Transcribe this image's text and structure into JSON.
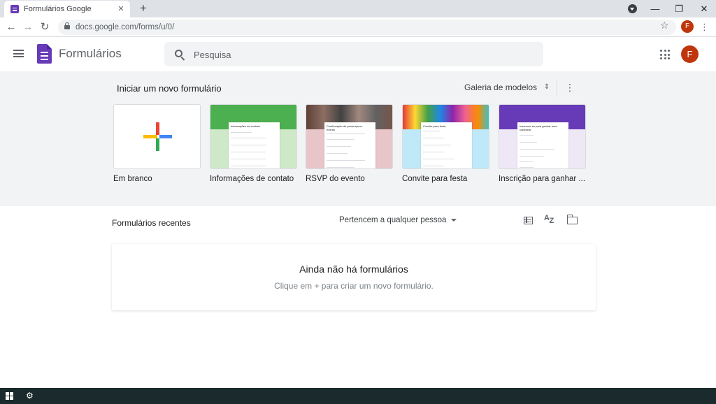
{
  "browser": {
    "tab_title": "Formulários Google",
    "tab_close": "✕",
    "new_tab": "+",
    "url": "docs.google.com/forms/u/0/",
    "avatar_letter": "F",
    "window_controls": {
      "minimize": "—",
      "restore": "❐",
      "close": "✕"
    },
    "nav": {
      "back": "←",
      "forward": "→",
      "reload": "↻",
      "star": "☆",
      "menu": "⋮"
    }
  },
  "header": {
    "app_title": "Formulários",
    "search_placeholder": "Pesquisa",
    "avatar_letter": "F",
    "avatar_color": "#bf360c"
  },
  "templates": {
    "heading": "Iniciar um novo formulário",
    "gallery_label": "Galeria de modelos",
    "gallery_icon": "⇕",
    "more_icon": "⋮",
    "items": [
      {
        "label": "Em branco"
      },
      {
        "label": "Informações de contato",
        "preview_title": "Informações de contato"
      },
      {
        "label": "RSVP do evento",
        "preview_title": "Confirmação de presença no evento"
      },
      {
        "label": "Convite para festa",
        "preview_title": "Convite para festa"
      },
      {
        "label": "Inscrição para ganhar ...",
        "preview_title": "Inscrever-se para ganhar uma camiseta"
      }
    ]
  },
  "recent": {
    "title": "Formulários recentes",
    "owner_filter": "Pertencem a qualquer pessoa",
    "sort_icon_a": "A",
    "sort_icon_z": "Z",
    "empty_title": "Ainda não há formulários",
    "empty_subtitle": "Clique em + para criar um novo formulário."
  },
  "taskbar": {
    "gear": "⚙"
  },
  "colors": {
    "accent": "#673ab7",
    "template_bg": "#f1f3f4"
  }
}
